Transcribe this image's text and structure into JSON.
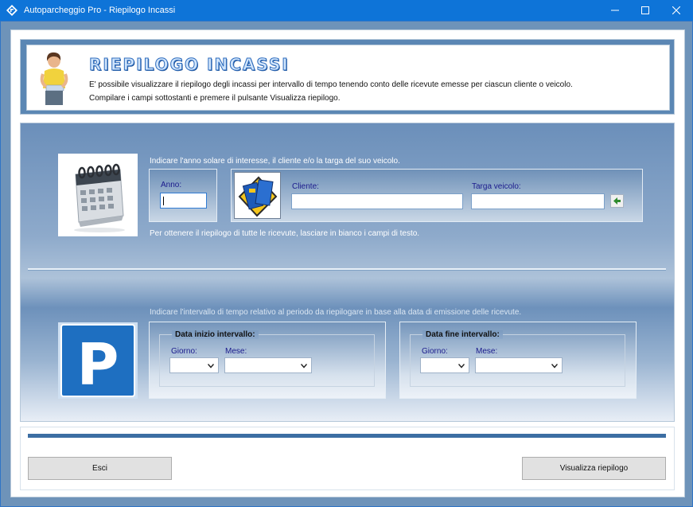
{
  "window": {
    "title": "Autoparcheggio Pro - Riepilogo Incassi",
    "accent": "#0e74d8",
    "icons": [
      "app-icon",
      "minimize-icon",
      "maximize-icon",
      "close-icon"
    ]
  },
  "header": {
    "title": "RIEPILOGO INCASSI",
    "line1": "E' possibile visualizzare il riepilogo degli incassi per intervallo di tempo tenendo conto delle ricevute emesse per ciascun cliente o veicolo.",
    "line2": "Compilare i campi sottostanti e premere il pulsante Visualizza riepilogo."
  },
  "filters": {
    "instruction_top": "Indicare l'anno solare di interesse, il cliente e/o la targa del suo veicolo.",
    "instruction_blank": "Per ottenere il riepilogo di tutte le ricevute, lasciare in bianco i campi di testo.",
    "anno_label": "Anno:",
    "anno_value": "",
    "cliente_label": "Cliente:",
    "cliente_value": "",
    "targa_label": "Targa veicolo:",
    "targa_value": ""
  },
  "interval": {
    "instruction": "Indicare l'intervallo di tempo relativo al periodo da riepilogare in base alla data di emissione delle ricevute.",
    "start": {
      "title": "Data inizio intervallo:",
      "giorno_label": "Giorno:",
      "mese_label": "Mese:",
      "giorno_value": "",
      "mese_value": ""
    },
    "end": {
      "title": "Data fine intervallo:",
      "giorno_label": "Giorno:",
      "mese_label": "Mese:",
      "giorno_value": "",
      "mese_value": ""
    }
  },
  "buttons": {
    "esci": "Esci",
    "visualizza": "Visualizza riepilogo"
  }
}
